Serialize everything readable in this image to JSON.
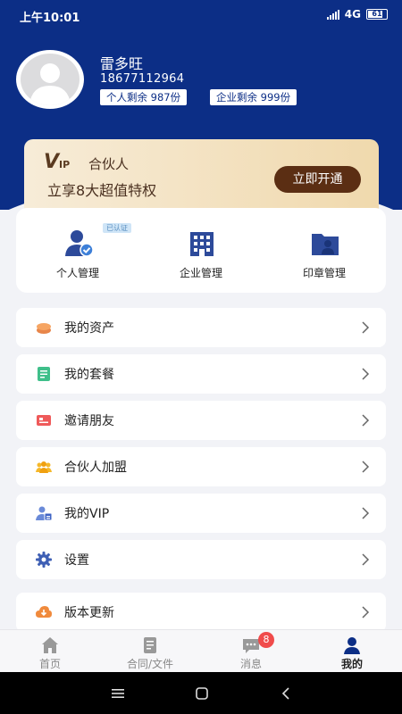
{
  "status_bar": {
    "time": "上午10:01",
    "network": "4G",
    "battery": "61"
  },
  "profile": {
    "name": "雷多旺",
    "phone": "18677112964",
    "personal_quota": "个人剩余 987份",
    "company_quota": "企业剩余 999份"
  },
  "vip": {
    "logo": "VIP",
    "title": "合伙人",
    "subtitle": "立享8大超值特权",
    "button": "立即开通"
  },
  "quick_actions": {
    "verified_tag": "已认证",
    "items": [
      {
        "label": "个人管理",
        "icon": "user-check-icon"
      },
      {
        "label": "企业管理",
        "icon": "building-icon"
      },
      {
        "label": "印章管理",
        "icon": "folder-seal-icon"
      }
    ]
  },
  "menu": [
    {
      "label": "我的资产",
      "icon": "coins-icon"
    },
    {
      "label": "我的套餐",
      "icon": "package-icon"
    },
    {
      "label": "邀请朋友",
      "icon": "invite-icon"
    },
    {
      "label": "合伙人加盟",
      "icon": "partners-icon"
    },
    {
      "label": "我的VIP",
      "icon": "vip-user-icon"
    },
    {
      "label": "设置",
      "icon": "gear-icon"
    },
    {
      "label": "版本更新",
      "icon": "cloud-update-icon"
    }
  ],
  "bottom_nav": [
    {
      "label": "首页",
      "icon": "home-icon"
    },
    {
      "label": "合同/文件",
      "icon": "document-icon"
    },
    {
      "label": "消息",
      "icon": "message-icon",
      "badge": "8"
    },
    {
      "label": "我的",
      "icon": "profile-icon",
      "active": true
    }
  ],
  "colors": {
    "brand": "#0c2e86",
    "vip_button": "#5b2e13",
    "badge": "#f04b4b"
  }
}
